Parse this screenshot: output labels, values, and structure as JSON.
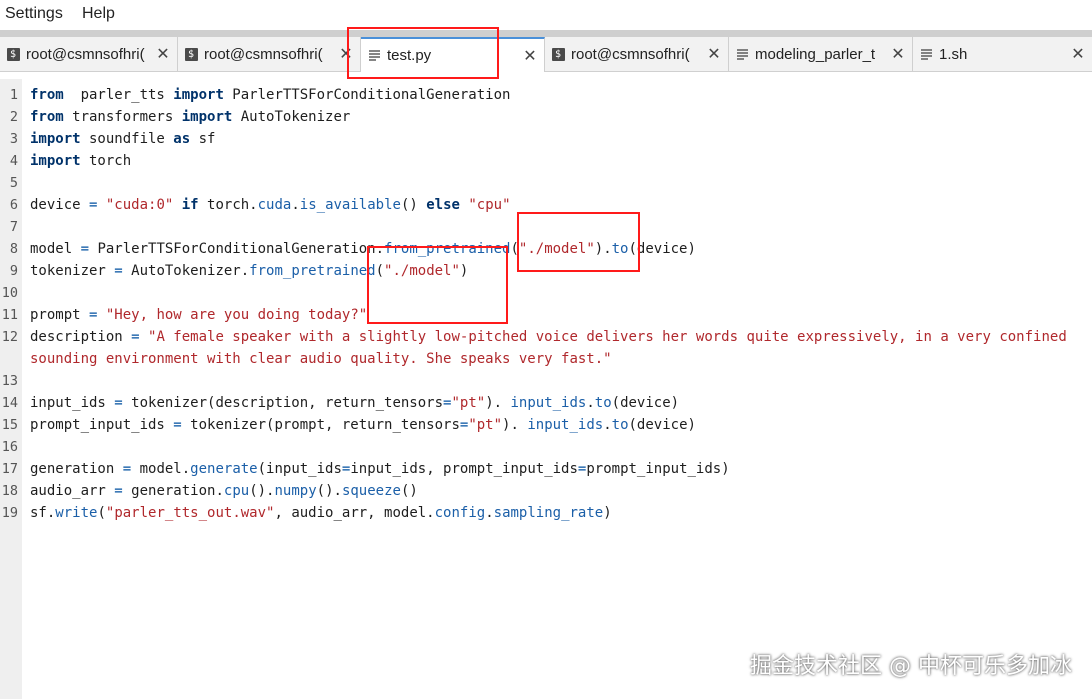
{
  "menu": {
    "items": [
      "Settings",
      "Help"
    ]
  },
  "tabs": [
    {
      "label": "root@csmnsofhri(",
      "icon": "terminal-icon",
      "close": "✕"
    },
    {
      "label": "root@csmnsofhri(",
      "icon": "terminal-icon",
      "close": "✕"
    },
    {
      "label": "test.py",
      "icon": "document-icon",
      "close": "✕",
      "active": true
    },
    {
      "label": "root@csmnsofhri(",
      "icon": "terminal-icon",
      "close": "✕"
    },
    {
      "label": "modeling_parler_t",
      "icon": "document-icon",
      "close": "✕"
    },
    {
      "label": "1.sh",
      "icon": "document-icon",
      "close": "✕"
    }
  ],
  "editor": {
    "lines": [
      {
        "n": "1",
        "tokens": [
          [
            "kw",
            "from"
          ],
          [
            "",
            "  parler_tts "
          ],
          [
            "kw",
            "import"
          ],
          [
            "",
            " ParlerTTSForConditionalGeneration"
          ]
        ]
      },
      {
        "n": "2",
        "tokens": [
          [
            "kw",
            "from"
          ],
          [
            "",
            " transformers "
          ],
          [
            "kw",
            "import"
          ],
          [
            "",
            " AutoTokenizer"
          ]
        ]
      },
      {
        "n": "3",
        "tokens": [
          [
            "kw",
            "import"
          ],
          [
            "",
            " soundfile "
          ],
          [
            "kw",
            "as"
          ],
          [
            "",
            " sf"
          ]
        ]
      },
      {
        "n": "4",
        "tokens": [
          [
            "kw",
            "import"
          ],
          [
            "",
            " torch"
          ]
        ]
      },
      {
        "n": "5",
        "tokens": []
      },
      {
        "n": "6",
        "tokens": [
          [
            "",
            "device "
          ],
          [
            "op",
            "="
          ],
          [
            " str",
            ""
          ],
          [
            "str",
            " \"cuda:0\""
          ],
          [
            "",
            " "
          ],
          [
            "kw",
            "if"
          ],
          [
            "",
            " torch."
          ],
          [
            "fn",
            "cuda"
          ],
          [
            "",
            "."
          ],
          [
            "fn",
            "is_available"
          ],
          [
            "",
            "() "
          ],
          [
            "kw",
            "else"
          ],
          [
            "str",
            " \"cpu\""
          ]
        ]
      },
      {
        "n": "7",
        "tokens": []
      },
      {
        "n": "8",
        "tokens": [
          [
            "",
            "model "
          ],
          [
            "op",
            "="
          ],
          [
            "",
            " ParlerTTSForConditionalGeneration."
          ],
          [
            "fn",
            "from_pretrained"
          ],
          [
            "",
            "("
          ],
          [
            "str",
            "\"./model\""
          ],
          [
            "",
            ")."
          ],
          [
            "fn",
            "to"
          ],
          [
            "",
            "(device)"
          ]
        ]
      },
      {
        "n": "9",
        "tokens": [
          [
            "",
            "tokenizer "
          ],
          [
            "op",
            "="
          ],
          [
            "",
            " AutoTokenizer."
          ],
          [
            "fn",
            "from_pretrained"
          ],
          [
            "",
            "("
          ],
          [
            "str",
            "\"./model\""
          ],
          [
            "",
            ")"
          ]
        ]
      },
      {
        "n": "10",
        "tokens": []
      },
      {
        "n": "11",
        "tokens": [
          [
            "",
            "prompt "
          ],
          [
            "op",
            "="
          ],
          [
            "str",
            " \"Hey, how are you doing today?\""
          ]
        ]
      },
      {
        "n": "12",
        "tokens": [
          [
            "",
            "description "
          ],
          [
            "op",
            "="
          ],
          [
            "str",
            " \"A female speaker with a slightly low-pitched voice delivers her words quite expressively, in a very confined"
          ]
        ]
      },
      {
        "n": "",
        "tokens": [
          [
            "str",
            "sounding environment with clear audio quality. She speaks very fast.\""
          ]
        ]
      },
      {
        "n": "13",
        "tokens": []
      },
      {
        "n": "14",
        "tokens": [
          [
            "",
            "input_ids "
          ],
          [
            "op",
            "="
          ],
          [
            "",
            " tokenizer(description, return_tensors"
          ],
          [
            "op",
            "="
          ],
          [
            "str",
            "\"pt\""
          ],
          [
            "",
            "). "
          ],
          [
            "fn",
            "input_ids"
          ],
          [
            "",
            "."
          ],
          [
            "fn",
            "to"
          ],
          [
            "",
            "(device)"
          ]
        ]
      },
      {
        "n": "15",
        "tokens": [
          [
            "",
            "prompt_input_ids "
          ],
          [
            "op",
            "="
          ],
          [
            "",
            " tokenizer(prompt, return_tensors"
          ],
          [
            "op",
            "="
          ],
          [
            "str",
            "\"pt\""
          ],
          [
            "",
            "). "
          ],
          [
            "fn",
            "input_ids"
          ],
          [
            "",
            "."
          ],
          [
            "fn",
            "to"
          ],
          [
            "",
            "(device)"
          ]
        ]
      },
      {
        "n": "16",
        "tokens": []
      },
      {
        "n": "17",
        "tokens": [
          [
            "",
            "generation "
          ],
          [
            "op",
            "="
          ],
          [
            "",
            " model."
          ],
          [
            "fn",
            "generate"
          ],
          [
            "",
            "(input_ids"
          ],
          [
            "op",
            "="
          ],
          [
            "",
            "input_ids, prompt_input_ids"
          ],
          [
            "op",
            "="
          ],
          [
            "",
            "prompt_input_ids)"
          ]
        ]
      },
      {
        "n": "18",
        "tokens": [
          [
            "",
            "audio_arr "
          ],
          [
            "op",
            "="
          ],
          [
            "",
            " generation."
          ],
          [
            "fn",
            "cpu"
          ],
          [
            "",
            "()."
          ],
          [
            "fn",
            "numpy"
          ],
          [
            "",
            "()."
          ],
          [
            "fn",
            "squeeze"
          ],
          [
            "",
            "()"
          ]
        ]
      },
      {
        "n": "19",
        "tokens": [
          [
            "",
            "sf."
          ],
          [
            "fn",
            "write"
          ],
          [
            "",
            "("
          ],
          [
            "str",
            "\"parler_tts_out.wav\""
          ],
          [
            "",
            ", audio_arr, model."
          ],
          [
            "fn",
            "config"
          ],
          [
            "",
            "."
          ],
          [
            "fn",
            "sampling_rate"
          ],
          [
            "",
            ")"
          ]
        ]
      }
    ]
  },
  "watermark": "掘金技术社区 @ 中杯可乐多加冰",
  "colors": {
    "annotation": "#ff1a1a",
    "keyword": "#00326a",
    "string": "#b0282c",
    "attr": "#1b5fa8"
  }
}
